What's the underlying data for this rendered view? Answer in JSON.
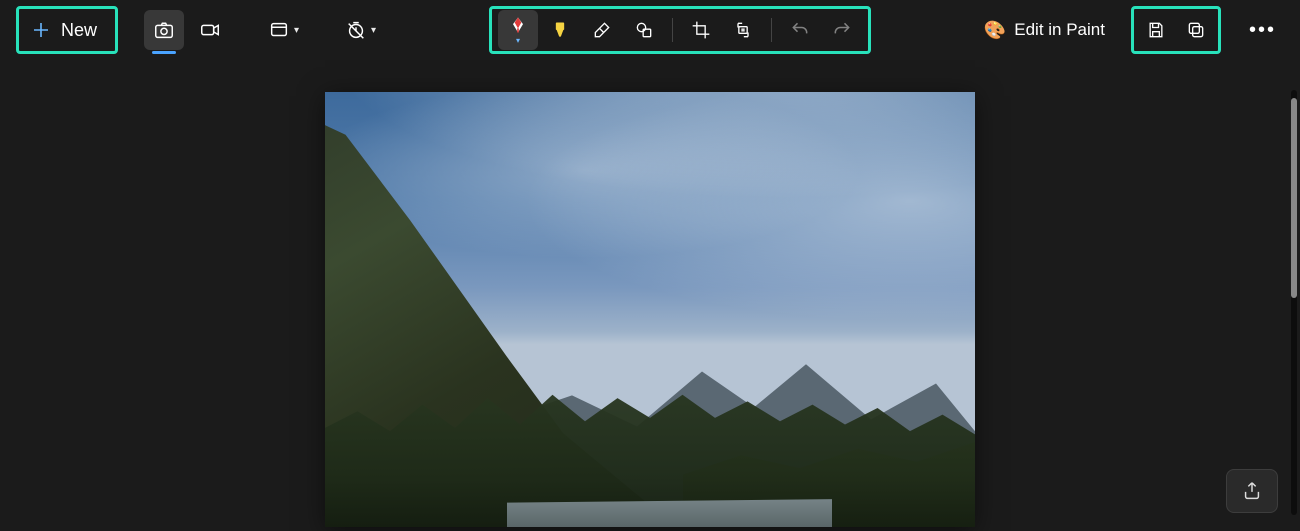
{
  "toolbar": {
    "new_label": "New",
    "edit_in_paint_label": "Edit in Paint"
  },
  "icons": {
    "plus": "plus-icon",
    "camera": "camera-icon",
    "video": "video-icon",
    "window_snip": "window-snip-icon",
    "delay": "delay-timer-icon",
    "pen": "ballpoint-pen-icon",
    "highlighter": "highlighter-icon",
    "eraser": "eraser-icon",
    "shapes": "shapes-icon",
    "crop": "crop-icon",
    "text_extract": "text-actions-icon",
    "undo": "undo-icon",
    "redo": "redo-icon",
    "palette": "paint-palette-icon",
    "save": "save-icon",
    "copy": "copy-icon",
    "more": "more-icon",
    "share": "share-icon"
  },
  "colors": {
    "highlight_box": "#28e2bb",
    "pen_color": "#e23b3b",
    "highlighter_color": "#f5d342",
    "camera_underline": "#4aa3ff",
    "background": "#1b1b1b"
  },
  "state": {
    "active_capture_mode": "snapshot",
    "active_markup_tool": "pen",
    "undo_enabled": false,
    "redo_enabled": false
  },
  "annotation": {
    "highlighted_regions": [
      "new-button",
      "markup-tools-group",
      "save-copy-group"
    ]
  },
  "canvas": {
    "image_description": "Mountain landscape with pine-covered slope on the left, rocky mountain range in the distance, wispy clouds in a blue sky, and a small lake in the foreground"
  }
}
